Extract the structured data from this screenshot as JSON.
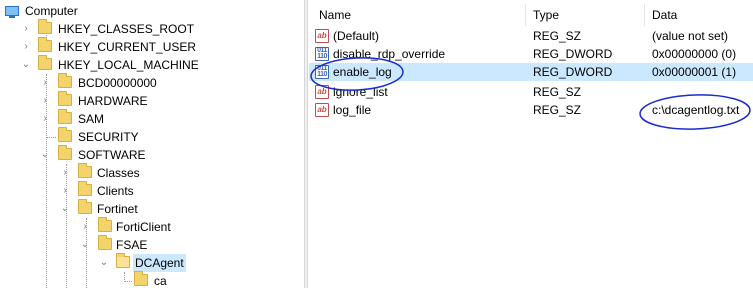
{
  "tree": {
    "items": [
      {
        "label": "Computer",
        "type": "computer",
        "toggle": "chevron-down"
      },
      {
        "label": "HKEY_CLASSES_ROOT",
        "toggle": "chevron-right"
      },
      {
        "label": "HKEY_CURRENT_USER",
        "toggle": "chevron-right"
      },
      {
        "label": "HKEY_LOCAL_MACHINE",
        "toggle": "chevron-down"
      },
      {
        "label": "BCD00000000",
        "toggle": "chevron-right"
      },
      {
        "label": "HARDWARE",
        "toggle": "chevron-right"
      },
      {
        "label": "SAM",
        "toggle": "chevron-right"
      },
      {
        "label": "SECURITY",
        "toggle": ""
      },
      {
        "label": "SOFTWARE",
        "toggle": "chevron-down"
      },
      {
        "label": "Classes",
        "toggle": "chevron-right"
      },
      {
        "label": "Clients",
        "toggle": "chevron-right"
      },
      {
        "label": "Fortinet",
        "toggle": "chevron-down"
      },
      {
        "label": "FortiClient",
        "toggle": "chevron-right"
      },
      {
        "label": "FSAE",
        "toggle": "chevron-down"
      },
      {
        "label": "DCAgent",
        "toggle": "chevron-down",
        "selected": true
      },
      {
        "label": "ca",
        "toggle": ""
      }
    ]
  },
  "list": {
    "headers": {
      "name": "Name",
      "type": "Type",
      "data": "Data"
    },
    "rows": [
      {
        "name": "(Default)",
        "type": "REG_SZ",
        "data": "(value not set)",
        "icon": "string-value-icon"
      },
      {
        "name": "disable_rdp_override",
        "type": "REG_DWORD",
        "data": "0x00000000 (0)",
        "icon": "dword-value-icon"
      },
      {
        "name": "enable_log",
        "type": "REG_DWORD",
        "data": "0x00000001 (1)",
        "icon": "dword-value-icon",
        "selected": true
      },
      {
        "name": "ignore_list",
        "type": "REG_SZ",
        "data": "",
        "icon": "string-value-icon"
      },
      {
        "name": "log_file",
        "type": "REG_SZ",
        "data": "c:\\dcagentlog.txt",
        "icon": "string-value-icon"
      }
    ]
  },
  "annotations": {
    "color": "#1a2ccf"
  },
  "icons": {
    "string_glyph": "ab",
    "dword_glyph": "011\n110"
  }
}
